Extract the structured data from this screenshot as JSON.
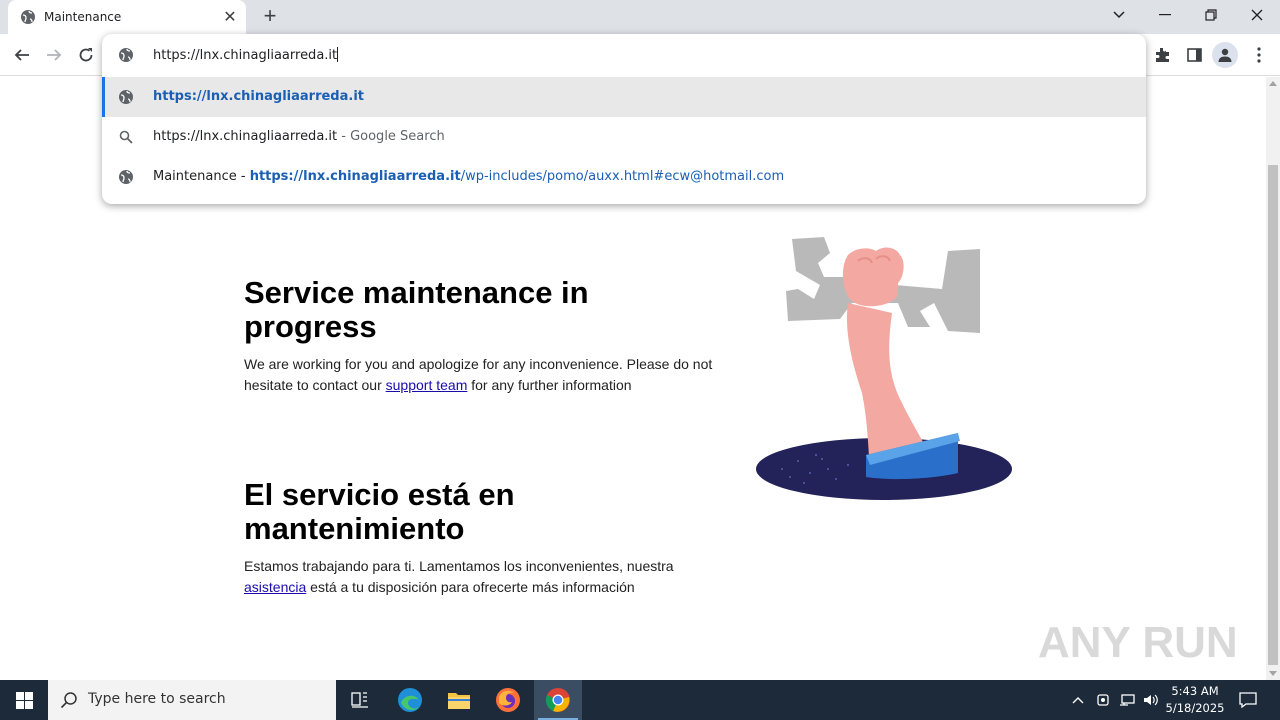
{
  "browser": {
    "tab_title": "Maintenance",
    "new_tab_label": "+",
    "address_text": "https://lnx.chinagliaarreda.it"
  },
  "omnibox": {
    "suggestions": [
      {
        "icon": "globe-icon",
        "bold_url": "https://lnx.chinagliaarreda.it",
        "selected": true
      },
      {
        "icon": "search-icon",
        "text": "https://lnx.chinagliaarreda.it",
        "suffix": " - Google Search"
      },
      {
        "icon": "globe-icon",
        "prefix": "Maintenance - ",
        "bold_url": "https://lnx.chinagliaarreda.it",
        "rest_url": "/wp-includes/pomo/auxx.html#ecw@hotmail.com"
      }
    ]
  },
  "page": {
    "en": {
      "heading": "Service maintenance in progress",
      "text_before_link": "We are working for you and apologize for any inconvenience. Please do not hesitate to contact our ",
      "link": "support team",
      "text_after_link": " for any further information"
    },
    "es": {
      "heading": "El servicio está en mantenimiento",
      "text_before_link": "Estamos trabajando para ti. Lamentamos los inconvenientes, nuestra ",
      "link": "asistencia",
      "text_after_link": " está a tu disposición para ofrecerte más información"
    },
    "watermark": "ANY RUN"
  },
  "taskbar": {
    "search_placeholder": "Type here to search",
    "time": "5:43 AM",
    "date": "5/18/2025"
  },
  "colors": {
    "link": "#1a0dab",
    "omnibox_url": "#1a5fb4",
    "taskbar_bg": "#1c2a3a"
  }
}
